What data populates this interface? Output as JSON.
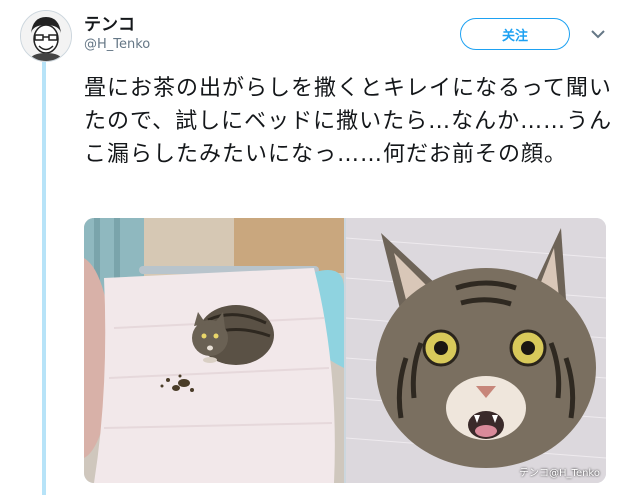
{
  "account": {
    "display_name": "テンコ",
    "handle": "@H_Tenko"
  },
  "actions": {
    "follow_label": "关注",
    "more_icon": "chevron-down-icon"
  },
  "tweet": {
    "text": "畳にお茶の出がらしを撒くとキレイになるって聞いたので、試しにベッドに撒いたら…なんか……うんこ漏らしたみたいになっ……何だお前その顔。"
  },
  "media": {
    "photos": [
      {
        "subject": "cat on bed with scattered tea leaves"
      },
      {
        "subject": "close-up of cat surprised face"
      }
    ],
    "watermark": "テンコ@H_Tenko"
  },
  "colors": {
    "accent": "#1da1f2",
    "thread_line": "#b7e3f8",
    "text": "#14171a",
    "secondary_text": "#657786"
  }
}
